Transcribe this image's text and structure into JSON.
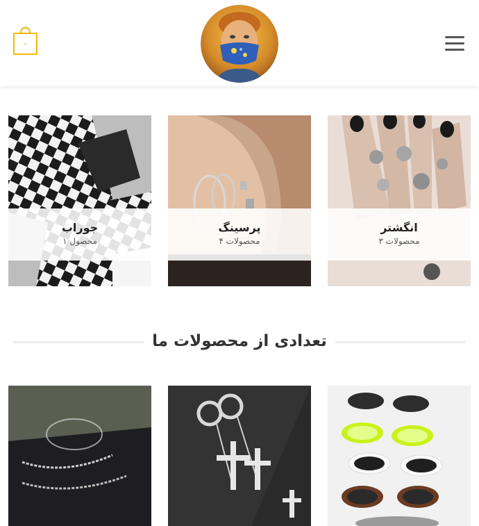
{
  "header": {
    "cart_count": "۰",
    "logo_alt": "site-logo",
    "menu_icon": "hamburger-menu-icon",
    "cart_icon": "shopping-bag-icon"
  },
  "categories": [
    {
      "title": "جوراب",
      "count": "۱ محصول"
    },
    {
      "title": "پرسینگ",
      "count": "۴ محصولات"
    },
    {
      "title": "انگشتر",
      "count": "۳ محصولات"
    }
  ],
  "section": {
    "title": "تعدادی از محصولات ما"
  },
  "colors": {
    "accent": "#f5b800",
    "divider": "#ececec"
  }
}
